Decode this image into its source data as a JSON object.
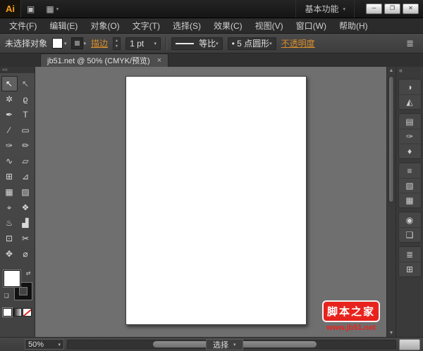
{
  "titlebar": {
    "logo": "Ai",
    "bridge_icon": "▣",
    "arrange_icon": "▦",
    "caret": "▾",
    "workspace": "基本功能",
    "minimize": "─",
    "maximize": "❐",
    "close": "✕"
  },
  "menus": [
    "文件(F)",
    "编辑(E)",
    "对象(O)",
    "文字(T)",
    "选择(S)",
    "效果(C)",
    "视图(V)",
    "窗口(W)",
    "帮助(H)"
  ],
  "controlbar": {
    "no_selection": "未选择对象",
    "stroke_link": "描边",
    "stroke_weight": "1 pt",
    "profile_label": "等比",
    "brush_bullet": "•",
    "brush_label": "5 点圆形",
    "opacity_link": "不透明度",
    "caret": "▾",
    "step_up": "▴",
    "step_down": "▾",
    "panel_menu": "≣"
  },
  "tab": {
    "title": "jb51.net @ 50% (CMYK/预览)",
    "close": "×"
  },
  "toolpanel": {
    "collapse": "««",
    "swap_icon": "⇄",
    "default_icon": "❏"
  },
  "tools": [
    {
      "name": "selection-tool",
      "glyph": "↖",
      "selected": true
    },
    {
      "name": "direct-selection-tool",
      "glyph": "↖",
      "selected": false
    },
    {
      "name": "magic-wand-tool",
      "glyph": "✲",
      "selected": false
    },
    {
      "name": "lasso-tool",
      "glyph": "ϱ",
      "selected": false
    },
    {
      "name": "pen-tool",
      "glyph": "✒",
      "selected": false
    },
    {
      "name": "type-tool",
      "glyph": "T",
      "selected": false
    },
    {
      "name": "line-segment-tool",
      "glyph": "∕",
      "selected": false
    },
    {
      "name": "rectangle-tool",
      "glyph": "▭",
      "selected": false
    },
    {
      "name": "paintbrush-tool",
      "glyph": "✑",
      "selected": false
    },
    {
      "name": "pencil-tool",
      "glyph": "✏",
      "selected": false
    },
    {
      "name": "width-tool",
      "glyph": "∿",
      "selected": false
    },
    {
      "name": "free-transform-tool",
      "glyph": "▱",
      "selected": false
    },
    {
      "name": "shape-builder-tool",
      "glyph": "⊞",
      "selected": false
    },
    {
      "name": "perspective-grid-tool",
      "glyph": "⊿",
      "selected": false
    },
    {
      "name": "mesh-tool",
      "glyph": "▦",
      "selected": false
    },
    {
      "name": "gradient-tool",
      "glyph": "▨",
      "selected": false
    },
    {
      "name": "eyedropper-tool",
      "glyph": "⌖",
      "selected": false
    },
    {
      "name": "blend-tool",
      "glyph": "❖",
      "selected": false
    },
    {
      "name": "symbol-sprayer-tool",
      "glyph": "♨",
      "selected": false
    },
    {
      "name": "column-graph-tool",
      "glyph": "▟",
      "selected": false
    },
    {
      "name": "artboard-tool",
      "glyph": "⊡",
      "selected": false
    },
    {
      "name": "slice-tool",
      "glyph": "✂",
      "selected": false
    },
    {
      "name": "hand-tool",
      "glyph": "✥",
      "selected": false
    },
    {
      "name": "zoom-tool",
      "glyph": "⌀",
      "selected": false
    }
  ],
  "vscroll": {
    "up": "▲",
    "down": "▼"
  },
  "dock": {
    "collapse": "«",
    "icons": [
      {
        "name": "color-panel",
        "glyph": "◑"
      },
      {
        "name": "color-guide-panel",
        "glyph": "◭"
      },
      {
        "name": "swatches-panel",
        "glyph": "▤"
      },
      {
        "name": "brushes-panel",
        "glyph": "✑"
      },
      {
        "name": "symbols-panel",
        "glyph": "♦"
      },
      {
        "name": "stroke-panel",
        "glyph": "≡"
      },
      {
        "name": "gradient-panel",
        "glyph": "▧"
      },
      {
        "name": "transparency-panel",
        "glyph": "▦"
      },
      {
        "name": "appearance-panel",
        "glyph": "◉"
      },
      {
        "name": "graphic-styles-panel",
        "glyph": "❏"
      },
      {
        "name": "layers-panel",
        "glyph": "≣"
      },
      {
        "name": "artboards-panel",
        "glyph": "⊞"
      }
    ]
  },
  "statusbar": {
    "zoom": "50%",
    "caret": "▾",
    "status": "选择",
    "status_caret": "▾"
  },
  "watermark": {
    "title": "脚本之家",
    "url": "www.jb51.net"
  },
  "colors": {
    "accent_orange": "#d98e2b",
    "watermark_red": "#e8231d",
    "canvas_gray": "#6f6f6f",
    "artboard_white": "#ffffff"
  }
}
